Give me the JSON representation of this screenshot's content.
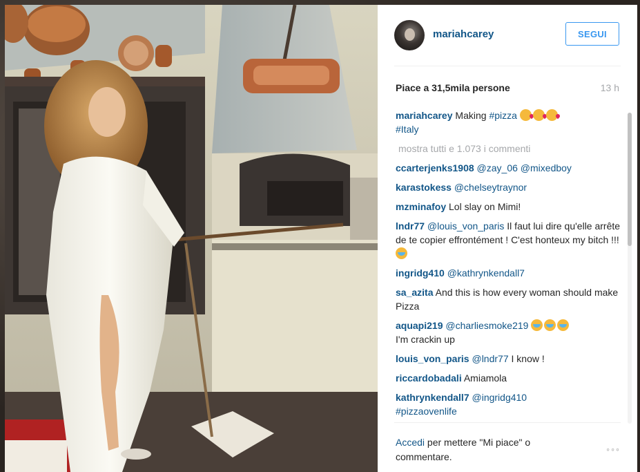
{
  "post": {
    "username": "mariahcarey",
    "follow_label": "SEGUI",
    "likes": "Piace a 31,5mila persone",
    "time": "13 h",
    "caption_user": "mariahcarey",
    "caption_text": "Making",
    "caption_tag1": "#pizza",
    "caption_tag2": "#Italy",
    "more_comments": "mostra tutti e 1.073 i commenti"
  },
  "comments": [
    {
      "user": "ccarterjenks1908",
      "mention": "@zay_06 @mixedboy",
      "text": ""
    },
    {
      "user": "karastokess",
      "mention": "@chelseytraynor",
      "text": ""
    },
    {
      "user": "mzminafoy",
      "mention": "",
      "text": "Lol slay on Mimi!"
    },
    {
      "user": "lndr77",
      "mention": "@louis_von_paris",
      "text": "Il faut lui dire qu'elle arrête de te copier effrontément ! C'est honteux my bitch !!!"
    },
    {
      "user": "ingridg410",
      "mention": "@kathrynkendall7",
      "text": ""
    },
    {
      "user": "sa_azita",
      "mention": "",
      "text": "And this is how every woman should make Pizza"
    },
    {
      "user": "aquapi219",
      "mention": "@charliesmoke219",
      "text": "I'm crackin up"
    },
    {
      "user": "louis_von_paris",
      "mention": "@lndr77",
      "text": "I know !"
    },
    {
      "user": "riccardobadali",
      "mention": "",
      "text": "Amiamola"
    },
    {
      "user": "kathrynkendall7",
      "mention": "@ingridg410",
      "text": "#pizzaovenlife"
    }
  ],
  "footer": {
    "login_link": "Accedi",
    "login_text": "per mettere \"Mi piace\" o commentare.",
    "more_label": "◦◦◦"
  },
  "icons": {
    "more_options": "more-options-icon",
    "avatar": "avatar-image"
  }
}
